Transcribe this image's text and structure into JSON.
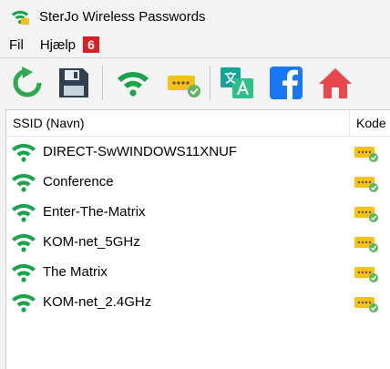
{
  "window": {
    "title": "SterJo Wireless Passwords",
    "app_icon": "wifi-icon"
  },
  "menu": {
    "file": "Fil",
    "help": "Hjælp",
    "badge": "6"
  },
  "toolbar": {
    "buttons": [
      {
        "name": "refresh-icon"
      },
      {
        "name": "save-icon"
      },
      {
        "name": "wifi-icon"
      },
      {
        "name": "password-key-icon"
      },
      {
        "name": "translate-icon"
      },
      {
        "name": "facebook-icon"
      },
      {
        "name": "home-icon"
      }
    ]
  },
  "table": {
    "headers": {
      "ssid": "SSID (Navn)",
      "key": "Kode"
    },
    "rows": [
      {
        "ssid": "DIRECT-SwWINDOWS11XNUF"
      },
      {
        "ssid": "Conference"
      },
      {
        "ssid": "Enter-The-Matrix"
      },
      {
        "ssid": "KOM-net_5GHz"
      },
      {
        "ssid": "The Matrix"
      },
      {
        "ssid": "KOM-net_2.4GHz"
      }
    ]
  },
  "colors": {
    "wifi_green": "#1aa34a",
    "key_yellow": "#f2c21b",
    "check_green": "#5cb85c",
    "facebook_blue": "#1877f2",
    "home_red": "#e8474b",
    "translate_teal": "#16a39a",
    "badge_red": "#d81f26"
  }
}
